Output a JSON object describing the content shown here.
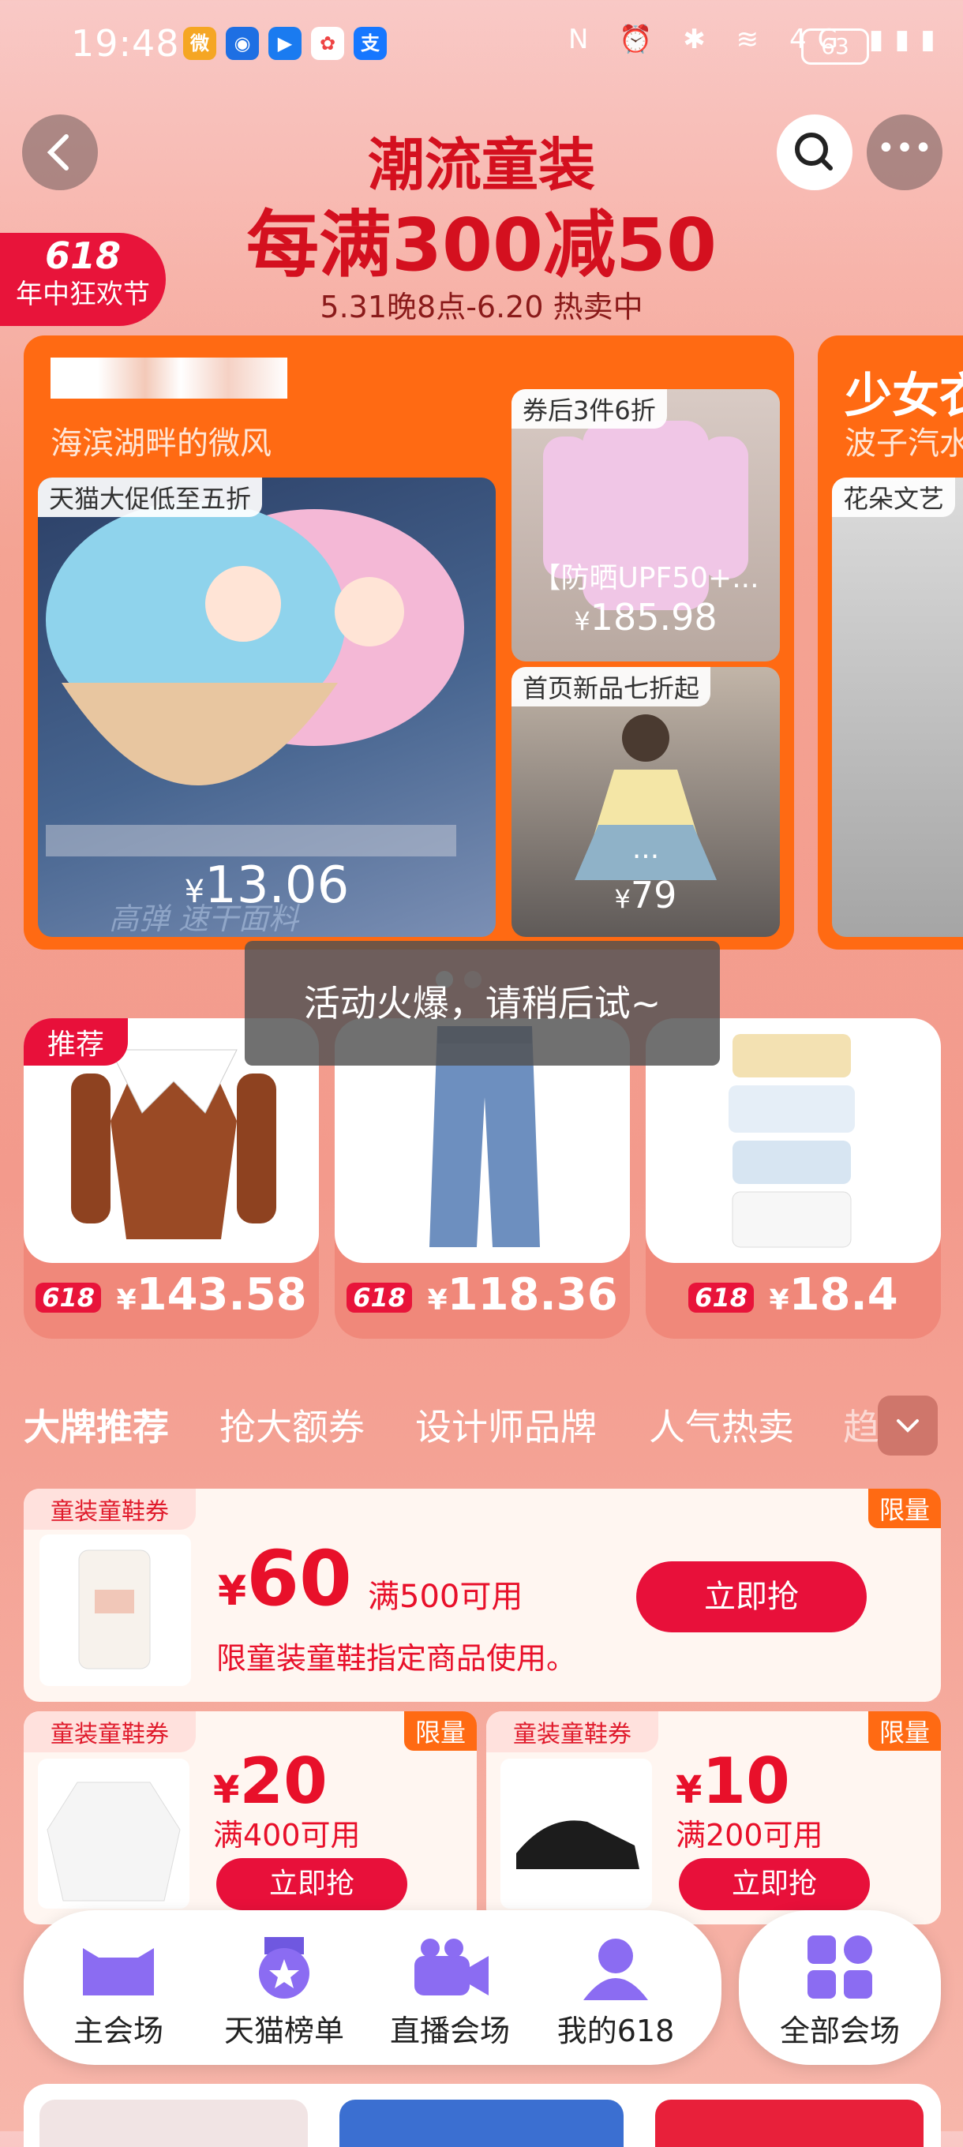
{
  "status_bar": {
    "time": "19:48",
    "battery": "63",
    "apps": [
      "微",
      "◉",
      "▶",
      "✿",
      "支"
    ],
    "indicators": "N ⏰ ✱ ≋ 4G ▮▮▮"
  },
  "header": {
    "title": "潮流童装",
    "promo": "每满300减50",
    "date_range": "5.31晚8点-6.20 热卖中",
    "badge_618": "618",
    "badge_sub": "年中狂欢节"
  },
  "store_card": {
    "subtitle": "海滨湖畔的微风",
    "main_tag": "天猫大促低至五折",
    "main_price": "13.06",
    "main_watermark": "高弹 速干面料",
    "side_items": [
      {
        "tag": "券后3件6折",
        "title": "【防晒UPF50+...",
        "price": "185.98"
      },
      {
        "tag": "首页新品七折起",
        "title": "...",
        "price": "79"
      }
    ]
  },
  "store_card_2": {
    "title": "少女衣",
    "subtitle": "波子汽水",
    "tag": "花朵文艺"
  },
  "toast": "活动火爆，请稍后试~",
  "recommend_badge": "推荐",
  "products": [
    {
      "price": "143.58"
    },
    {
      "price": "118.36"
    },
    {
      "price": "18.4"
    }
  ],
  "currency": "¥",
  "tabs": [
    "大牌推荐",
    "抢大额券",
    "设计师品牌",
    "人气热卖",
    "趋"
  ],
  "coupons": {
    "big": {
      "tag": "童装童鞋券",
      "limit": "限量",
      "amount": "60",
      "condition": "满500可用",
      "desc": "限童装童鞋指定商品使用。",
      "button": "立即抢"
    },
    "small": [
      {
        "tag": "童装童鞋券",
        "limit": "限量",
        "amount": "20",
        "condition": "满400可用",
        "button": "立即抢"
      },
      {
        "tag": "童装童鞋券",
        "limit": "限量",
        "amount": "10",
        "condition": "满200可用",
        "button": "立即抢"
      }
    ]
  },
  "bottom_nav": [
    {
      "label": "主会场",
      "icon": "cat-head-icon"
    },
    {
      "label": "天猫榜单",
      "icon": "medal-icon"
    },
    {
      "label": "直播会场",
      "icon": "video-camera-icon"
    },
    {
      "label": "我的618",
      "icon": "user-icon"
    }
  ],
  "all_venues": {
    "label": "全部会场",
    "icon": "grid-icon"
  },
  "colors": {
    "accent_red": "#e8103a",
    "orange": "#ff6a13",
    "nav_purple": "#8b6cf2"
  }
}
